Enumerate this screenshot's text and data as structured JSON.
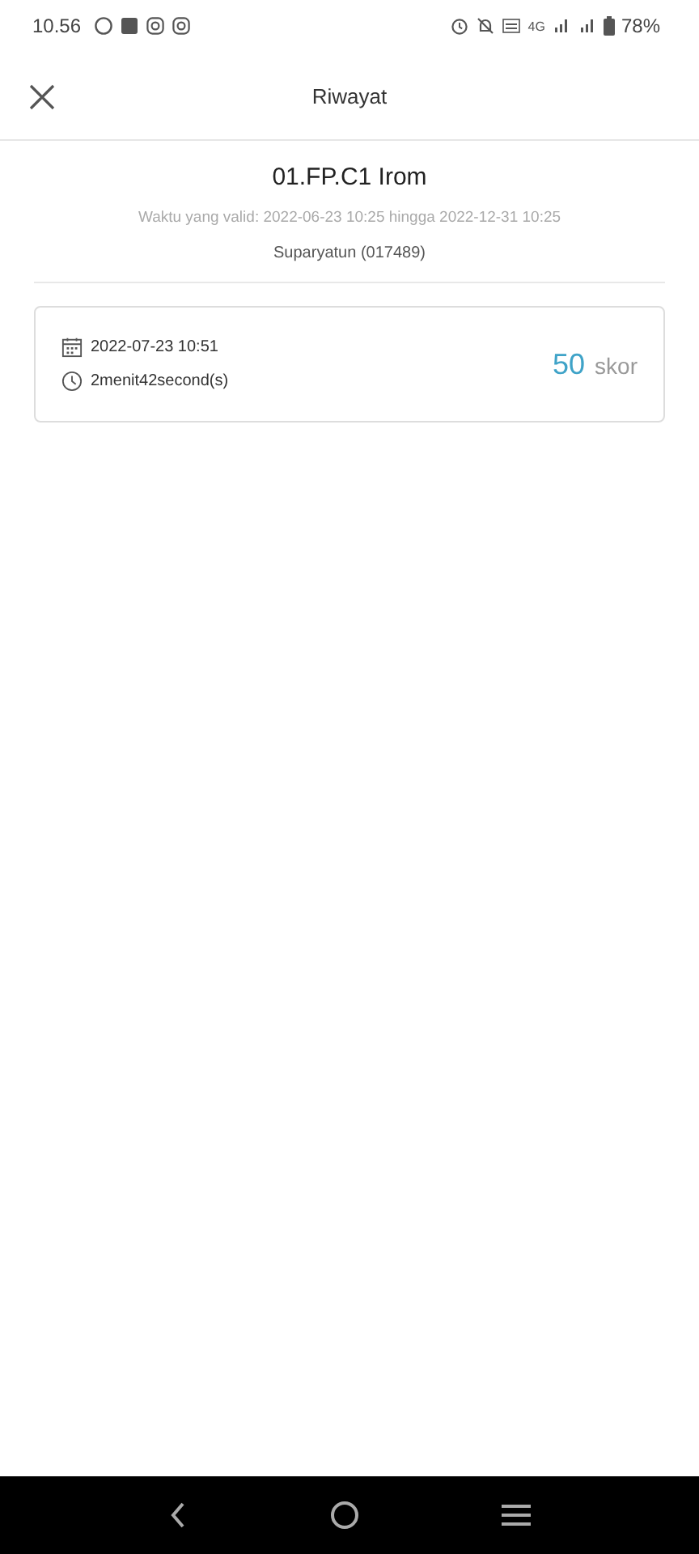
{
  "status_bar": {
    "time": "10.56",
    "network": "4G",
    "battery": "78%"
  },
  "header": {
    "title": "Riwayat"
  },
  "exam": {
    "title": "01.FP.C1 Irom",
    "validity": "Waktu yang valid: 2022-06-23 10:25 hingga 2022-12-31 10:25",
    "user": "Suparyatun (017489)"
  },
  "records": [
    {
      "date": "2022-07-23 10:51",
      "duration": "2menit42second(s)",
      "score": "50",
      "score_unit": "skor"
    }
  ]
}
